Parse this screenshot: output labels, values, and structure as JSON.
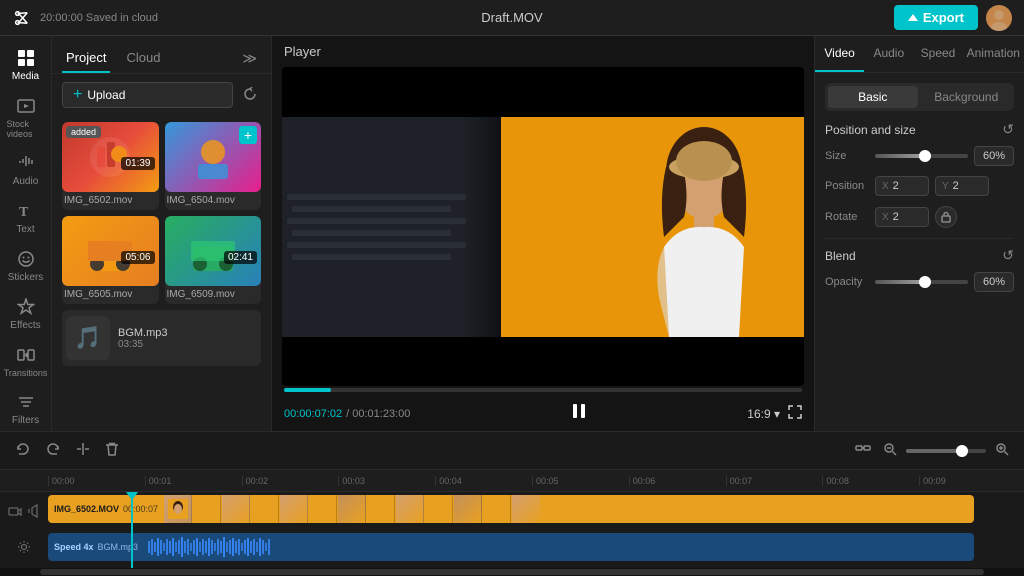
{
  "app": {
    "logo": "✂",
    "save_status": "20:00:00 Saved in cloud",
    "file_name": "Draft.MOV",
    "export_label": "Export"
  },
  "icon_sidebar": {
    "items": [
      {
        "id": "media",
        "label": "Media",
        "icon": "◫",
        "active": true
      },
      {
        "id": "stock-videos",
        "label": "Stock videos",
        "icon": "▶"
      },
      {
        "id": "audio",
        "label": "Audio",
        "icon": "♪"
      },
      {
        "id": "text",
        "label": "Text",
        "icon": "T"
      },
      {
        "id": "stickers",
        "label": "Stickers",
        "icon": "✦"
      },
      {
        "id": "effects",
        "label": "Effects",
        "icon": "✳"
      },
      {
        "id": "transitions",
        "label": "Transitions",
        "icon": "⇌"
      },
      {
        "id": "filters",
        "label": "Filters",
        "icon": "▦"
      }
    ]
  },
  "media_panel": {
    "tabs": [
      {
        "id": "project",
        "label": "Project",
        "active": true
      },
      {
        "id": "cloud",
        "label": "Cloud",
        "active": false
      }
    ],
    "upload_label": "Upload",
    "collapse_icon": "≫",
    "media_items": [
      {
        "id": 1,
        "name": "IMG_6502.mov",
        "duration": "01:39",
        "badge": "added"
      },
      {
        "id": 2,
        "name": "IMG_6504.mov",
        "duration": "",
        "badge": ""
      },
      {
        "id": 3,
        "name": "IMG_6505.mov",
        "duration": "05:06",
        "badge": ""
      },
      {
        "id": 4,
        "name": "IMG_6509.mov",
        "duration": "02:41",
        "badge": ""
      }
    ],
    "audio_item": {
      "name": "BGM.mp3",
      "duration": "03:35",
      "icon": "♪"
    }
  },
  "player": {
    "label": "Player",
    "current_time": "00:00:07:02",
    "total_time": "/ 00:01:23:00",
    "aspect_ratio": "16:9 ▾",
    "progress_pct": 9
  },
  "right_panel": {
    "tabs": [
      "Video",
      "Audio",
      "Speed",
      "Animation"
    ],
    "active_tab": "Video",
    "sub_tabs": [
      "Basic",
      "Background"
    ],
    "active_sub_tab": "Basic",
    "position_size": {
      "section_title": "Position and size",
      "size_label": "Size",
      "size_value": "60%",
      "position_label": "Position",
      "position_x_label": "X",
      "position_x_value": "2",
      "position_y_label": "Y",
      "position_y_value": "2",
      "rotate_label": "Rotate",
      "rotate_x_label": "X",
      "rotate_x_value": "2"
    },
    "blend": {
      "section_title": "Blend",
      "opacity_label": "Opacity",
      "opacity_value": "60%"
    }
  },
  "timeline": {
    "toolbar": {
      "undo": "↺",
      "redo": "↻",
      "split": "⊢",
      "delete": "🗑"
    },
    "ruler_marks": [
      "00:00",
      "00:01",
      "00:02",
      "00:03",
      "00:04",
      "00:05",
      "00:06",
      "00:07",
      "00:08",
      "00:09"
    ],
    "tracks": [
      {
        "id": "video",
        "label": "IMG_6502.MOV",
        "time_label": "00:00:07",
        "type": "video"
      },
      {
        "id": "audio",
        "label": "Speed 4x",
        "sublabel": "BGM.mp3",
        "type": "audio"
      }
    ]
  }
}
